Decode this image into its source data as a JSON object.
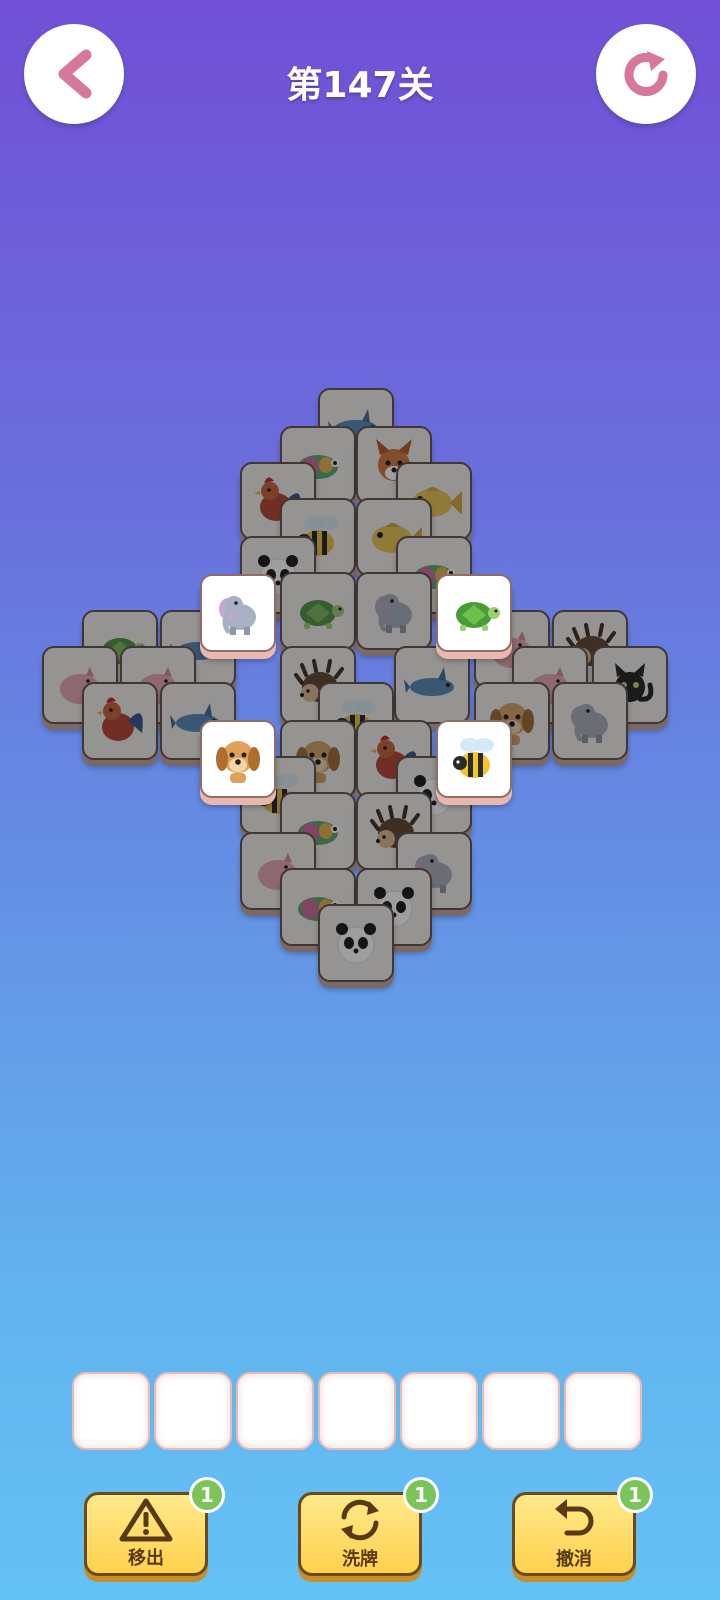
{
  "header": {
    "level_title": "第147关",
    "back_icon": "chevron-left-icon",
    "restart_icon": "restart-icon",
    "icon_color": "#d7779c"
  },
  "board": {
    "tiles": [
      {
        "animal": "dolphin",
        "state": "blocked"
      },
      {
        "animal": "chameleon",
        "state": "blocked"
      },
      {
        "animal": "fox",
        "state": "blocked"
      },
      {
        "animal": "rooster",
        "state": "blocked"
      },
      {
        "animal": "fish",
        "state": "blocked"
      },
      {
        "animal": "bee",
        "state": "blocked"
      },
      {
        "animal": "fish",
        "state": "blocked"
      },
      {
        "animal": "panda",
        "state": "blocked"
      },
      {
        "animal": "chameleon",
        "state": "blocked"
      },
      {
        "animal": "turtle",
        "state": "blocked"
      },
      {
        "animal": "elephant",
        "state": "blocked"
      },
      {
        "animal": "turtle",
        "state": "blocked"
      },
      {
        "animal": "dolphin",
        "state": "blocked"
      },
      {
        "animal": "pig",
        "state": "blocked"
      },
      {
        "animal": "hedgehog",
        "state": "blocked"
      },
      {
        "animal": "pig",
        "state": "blocked"
      },
      {
        "animal": "pig",
        "state": "blocked"
      },
      {
        "animal": "cat",
        "state": "blocked"
      },
      {
        "animal": "rooster",
        "state": "blocked"
      },
      {
        "animal": "pig",
        "state": "blocked"
      },
      {
        "animal": "dolphin",
        "state": "blocked"
      },
      {
        "animal": "hedgehog",
        "state": "blocked"
      },
      {
        "animal": "dolphin",
        "state": "blocked"
      },
      {
        "animal": "bee",
        "state": "blocked"
      },
      {
        "animal": "dog",
        "state": "blocked"
      },
      {
        "animal": "elephant",
        "state": "blocked"
      },
      {
        "animal": "dog",
        "state": "blocked"
      },
      {
        "animal": "rooster",
        "state": "blocked"
      },
      {
        "animal": "bee",
        "state": "blocked"
      },
      {
        "animal": "panda",
        "state": "blocked"
      },
      {
        "animal": "chameleon",
        "state": "blocked"
      },
      {
        "animal": "hedgehog",
        "state": "blocked"
      },
      {
        "animal": "pig",
        "state": "blocked"
      },
      {
        "animal": "elephant",
        "state": "blocked"
      },
      {
        "animal": "chameleon",
        "state": "blocked"
      },
      {
        "animal": "panda",
        "state": "blocked"
      },
      {
        "animal": "panda",
        "state": "blocked"
      },
      {
        "animal": "elephant",
        "state": "free"
      },
      {
        "animal": "turtle",
        "state": "free"
      },
      {
        "animal": "dog",
        "state": "free"
      },
      {
        "animal": "bee",
        "state": "free"
      }
    ]
  },
  "tray": {
    "slot_count": 7,
    "slots": [
      "",
      "",
      "",
      "",
      "",
      "",
      ""
    ]
  },
  "tools": [
    {
      "id": "move-out",
      "label": "移出",
      "count": "1",
      "icon": "warning-triangle-icon"
    },
    {
      "id": "shuffle",
      "label": "洗牌",
      "count": "1",
      "icon": "shuffle-cycle-icon"
    },
    {
      "id": "undo",
      "label": "撤消",
      "count": "1",
      "icon": "undo-arrow-icon"
    }
  ],
  "colors": {
    "bg_top": "#7150d6",
    "bg_bottom": "#64c2f5",
    "tool_fill": "#ffd14d",
    "badge": "#7cc35a"
  }
}
